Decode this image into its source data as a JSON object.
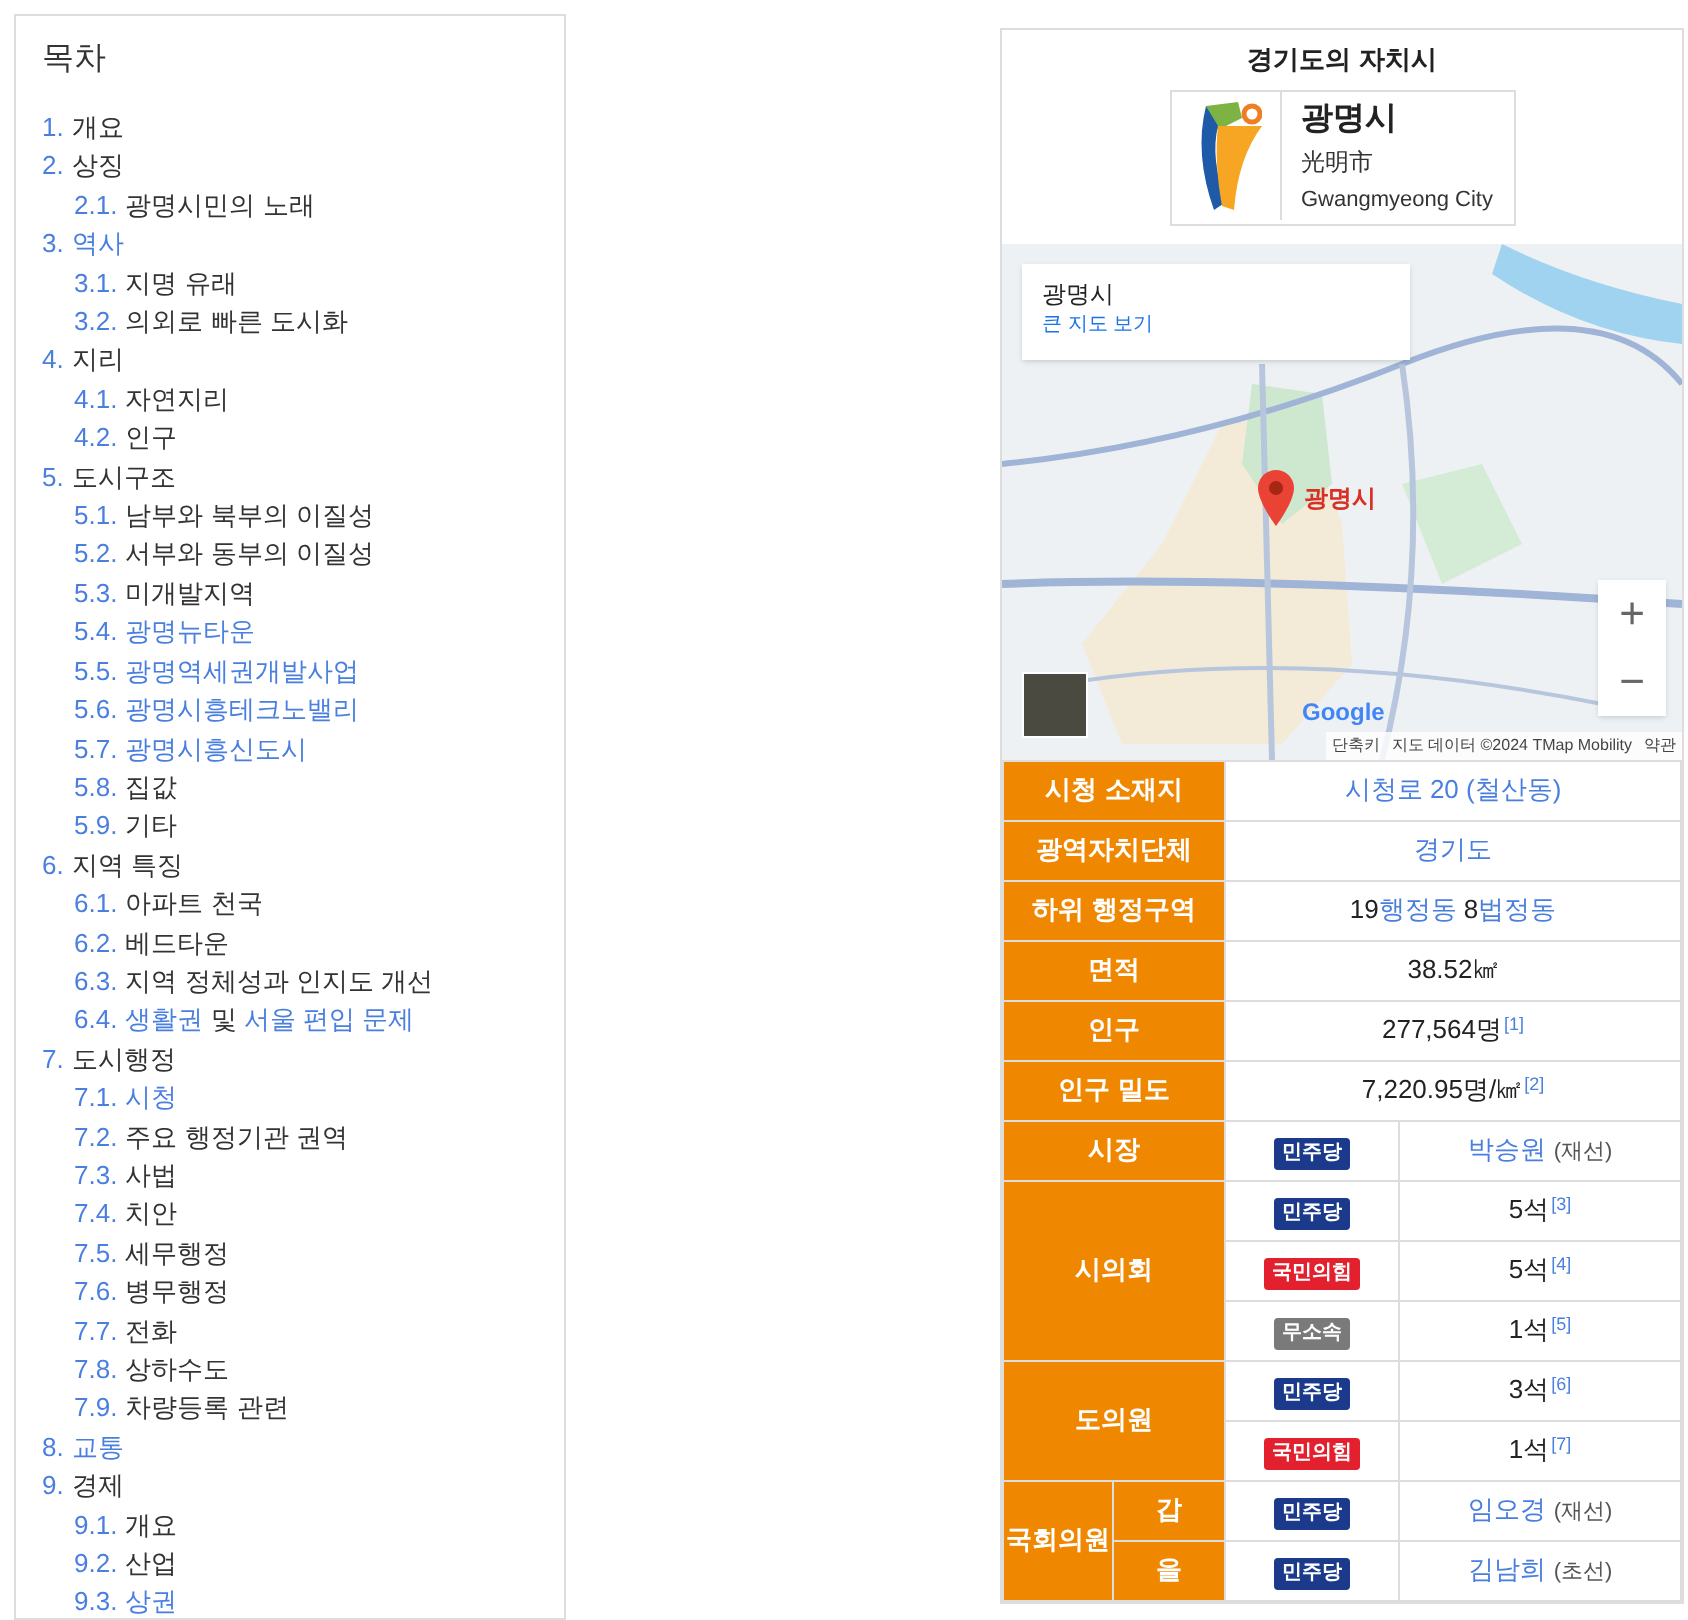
{
  "toc": {
    "title": "목차",
    "items": [
      {
        "number": "1.",
        "title": "개요",
        "link": false
      },
      {
        "number": "2.",
        "title": "상징",
        "link": false,
        "children": [
          {
            "number": "2.1.",
            "title": "광명시민의 노래",
            "link": false
          }
        ]
      },
      {
        "number": "3.",
        "title": "역사",
        "link": true,
        "children": [
          {
            "number": "3.1.",
            "title": "지명 유래",
            "link": false
          },
          {
            "number": "3.2.",
            "title": "의외로 빠른 도시화",
            "link": false
          }
        ]
      },
      {
        "number": "4.",
        "title": "지리",
        "link": false,
        "children": [
          {
            "number": "4.1.",
            "title": "자연지리",
            "link": false
          },
          {
            "number": "4.2.",
            "title": "인구",
            "link": false
          }
        ]
      },
      {
        "number": "5.",
        "title": "도시구조",
        "link": false,
        "children": [
          {
            "number": "5.1.",
            "title": "남부와 북부의 이질성",
            "link": false
          },
          {
            "number": "5.2.",
            "title": "서부와 동부의 이질성",
            "link": false
          },
          {
            "number": "5.3.",
            "title": "미개발지역",
            "link": false
          },
          {
            "number": "5.4.",
            "title": "광명뉴타운",
            "link": true
          },
          {
            "number": "5.5.",
            "title": "광명역세권개발사업",
            "link": true
          },
          {
            "number": "5.6.",
            "title": "광명시흥테크노밸리",
            "link": true
          },
          {
            "number": "5.7.",
            "title": "광명시흥신도시",
            "link": true
          },
          {
            "number": "5.8.",
            "title": "집값",
            "link": false
          },
          {
            "number": "5.9.",
            "title": "기타",
            "link": false
          }
        ]
      },
      {
        "number": "6.",
        "title": "지역 특징",
        "link": false,
        "children": [
          {
            "number": "6.1.",
            "title": "아파트 천국",
            "link": false
          },
          {
            "number": "6.2.",
            "title": "베드타운",
            "link": false
          },
          {
            "number": "6.3.",
            "title": "지역 정체성과 인지도 개선",
            "link": false
          },
          {
            "number": "6.4.",
            "parts": [
              {
                "text": "생활권",
                "link": true
              },
              {
                "text": " 및 ",
                "link": false
              },
              {
                "text": "서울 편입 문제",
                "link": true
              }
            ]
          }
        ]
      },
      {
        "number": "7.",
        "title": "도시행정",
        "link": false,
        "children": [
          {
            "number": "7.1.",
            "title": "시청",
            "link": true
          },
          {
            "number": "7.2.",
            "title": "주요 행정기관 권역",
            "link": false
          },
          {
            "number": "7.3.",
            "title": "사법",
            "link": false
          },
          {
            "number": "7.4.",
            "title": "치안",
            "link": false
          },
          {
            "number": "7.5.",
            "title": "세무행정",
            "link": false
          },
          {
            "number": "7.6.",
            "title": "병무행정",
            "link": false
          },
          {
            "number": "7.7.",
            "title": "전화",
            "link": false
          },
          {
            "number": "7.8.",
            "title": "상하수도",
            "link": false
          },
          {
            "number": "7.9.",
            "title": "차량등록 관련",
            "link": false
          }
        ]
      },
      {
        "number": "8.",
        "title": "교통",
        "link": true
      },
      {
        "number": "9.",
        "title": "경제",
        "link": false,
        "children": [
          {
            "number": "9.1.",
            "title": "개요",
            "link": false
          },
          {
            "number": "9.2.",
            "title": "산업",
            "link": false
          },
          {
            "number": "9.3.",
            "title": "상권",
            "link": true
          }
        ]
      }
    ]
  },
  "infobox": {
    "title": "경기도의 자치시",
    "name": "광명시",
    "hanja": "光明市",
    "english": "Gwangmyeong City",
    "map": {
      "place": "광명시",
      "link": "큰 지도 보기",
      "marker": "광명시",
      "logo": "Google",
      "shortcuts": "단축키",
      "attribution": "지도 데이터 ©2024 TMap Mobility",
      "terms": "약관",
      "zoom_in": "+",
      "zoom_out": "−"
    },
    "rows": [
      {
        "kind": "field",
        "label": "시청 소재지",
        "parts": [
          {
            "text": "시청로 20 (철산동)",
            "link": true
          }
        ]
      },
      {
        "kind": "field",
        "label": "광역자치단체",
        "parts": [
          {
            "text": "경기도",
            "link": true
          }
        ]
      },
      {
        "kind": "field",
        "label": "하위 행정구역",
        "parts": [
          {
            "text": "19",
            "link": false
          },
          {
            "text": "행정동",
            "link": true
          },
          {
            "text": " 8",
            "link": false
          },
          {
            "text": "법정동",
            "link": true
          }
        ]
      },
      {
        "kind": "field",
        "label": "면적",
        "parts": [
          {
            "text": "38.52㎢",
            "link": false
          }
        ]
      },
      {
        "kind": "field",
        "label": "인구",
        "parts": [
          {
            "text": "277,564명",
            "link": false
          }
        ],
        "note": "[1]"
      },
      {
        "kind": "field",
        "label": "인구 밀도",
        "parts": [
          {
            "text": "7,220.95명/㎢",
            "link": false
          }
        ],
        "note": "[2]"
      },
      {
        "kind": "party",
        "label": "시장",
        "entries": [
          {
            "party": "민주당",
            "color": "#1b3a8c",
            "value": "박승원",
            "link": true,
            "suffix": "(재선)"
          }
        ]
      },
      {
        "kind": "party",
        "label": "시의회",
        "entries": [
          {
            "party": "민주당",
            "color": "#1b3a8c",
            "value": "5석",
            "link": false,
            "note": "[3]"
          },
          {
            "party": "국민의힘",
            "color": "#e3202e",
            "value": "5석",
            "link": false,
            "note": "[4]"
          },
          {
            "party": "무소속",
            "color": "#7a7a7a",
            "value": "1석",
            "link": false,
            "note": "[5]"
          }
        ]
      },
      {
        "kind": "party",
        "label": "도의원",
        "entries": [
          {
            "party": "민주당",
            "color": "#1b3a8c",
            "value": "3석",
            "link": false,
            "note": "[6]"
          },
          {
            "party": "국민의힘",
            "color": "#e3202e",
            "value": "1석",
            "link": false,
            "note": "[7]"
          }
        ]
      },
      {
        "kind": "party",
        "label": "국회의원",
        "entries": [
          {
            "sublabel": "갑",
            "party": "민주당",
            "color": "#1b3a8c",
            "value": "임오경",
            "link": true,
            "suffix": "(재선)"
          },
          {
            "sublabel": "을",
            "party": "민주당",
            "color": "#1b3a8c",
            "value": "김남희",
            "link": true,
            "suffix": "(초선)"
          }
        ]
      }
    ]
  }
}
